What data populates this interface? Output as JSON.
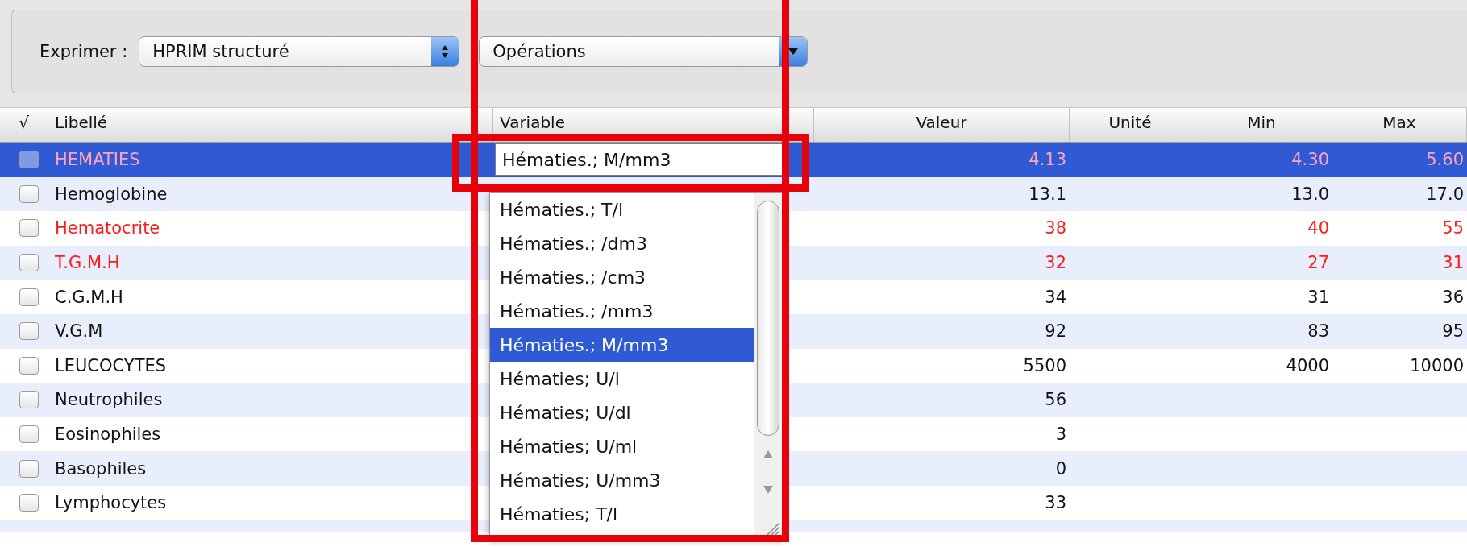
{
  "toolbar": {
    "label": "Exprimer :",
    "format_popup": "HPRIM structuré",
    "operations_popup": "Opérations"
  },
  "table": {
    "columns": [
      "√",
      "Libellé",
      "Variable",
      "Valeur",
      "Unité",
      "Min",
      "Max"
    ],
    "rows": [
      {
        "label": "HEMATIES",
        "value": "4.13",
        "min": "4.30",
        "max": "5.60",
        "abnormal": true,
        "selected": true,
        "checked": false
      },
      {
        "label": "Hemoglobine",
        "value": "13.1",
        "min": "13.0",
        "max": "17.0",
        "abnormal": false,
        "selected": false,
        "checked": false
      },
      {
        "label": "Hematocrite",
        "value": "38",
        "min": "40",
        "max": "55",
        "abnormal": true,
        "selected": false,
        "checked": false
      },
      {
        "label": "T.G.M.H",
        "value": "32",
        "min": "27",
        "max": "31",
        "abnormal": true,
        "selected": false,
        "checked": false
      },
      {
        "label": "C.G.M.H",
        "value": "34",
        "min": "31",
        "max": "36",
        "abnormal": false,
        "selected": false,
        "checked": false
      },
      {
        "label": "V.G.M",
        "value": "92",
        "min": "83",
        "max": "95",
        "abnormal": false,
        "selected": false,
        "checked": false
      },
      {
        "label": "LEUCOCYTES",
        "value": "5500",
        "min": "4000",
        "max": "10000",
        "abnormal": false,
        "selected": false,
        "checked": false
      },
      {
        "label": "Neutrophiles",
        "value": "56",
        "abnormal": false,
        "selected": false,
        "checked": false
      },
      {
        "label": "Eosinophiles",
        "value": "3",
        "abnormal": false,
        "selected": false,
        "checked": false
      },
      {
        "label": "Basophiles",
        "value": "0",
        "abnormal": false,
        "selected": false,
        "checked": false
      },
      {
        "label": "Lymphocytes",
        "value": "33",
        "abnormal": false,
        "selected": false,
        "checked": false
      }
    ]
  },
  "variable_editor": {
    "value": "Hématies.; M/mm3",
    "options": [
      {
        "label": "Hématies.; T/l",
        "selected": false
      },
      {
        "label": "Hématies.; /dm3",
        "selected": false
      },
      {
        "label": "Hématies.; /cm3",
        "selected": false
      },
      {
        "label": "Hématies.; /mm3",
        "selected": false
      },
      {
        "label": "Hématies.; M/mm3",
        "selected": true
      },
      {
        "label": "Hématies; U/l",
        "selected": false
      },
      {
        "label": "Hématies; U/dl",
        "selected": false
      },
      {
        "label": "Hématies; U/ml",
        "selected": false
      },
      {
        "label": "Hématies; U/mm3",
        "selected": false
      },
      {
        "label": "Hématies; T/l",
        "selected": false
      }
    ]
  }
}
